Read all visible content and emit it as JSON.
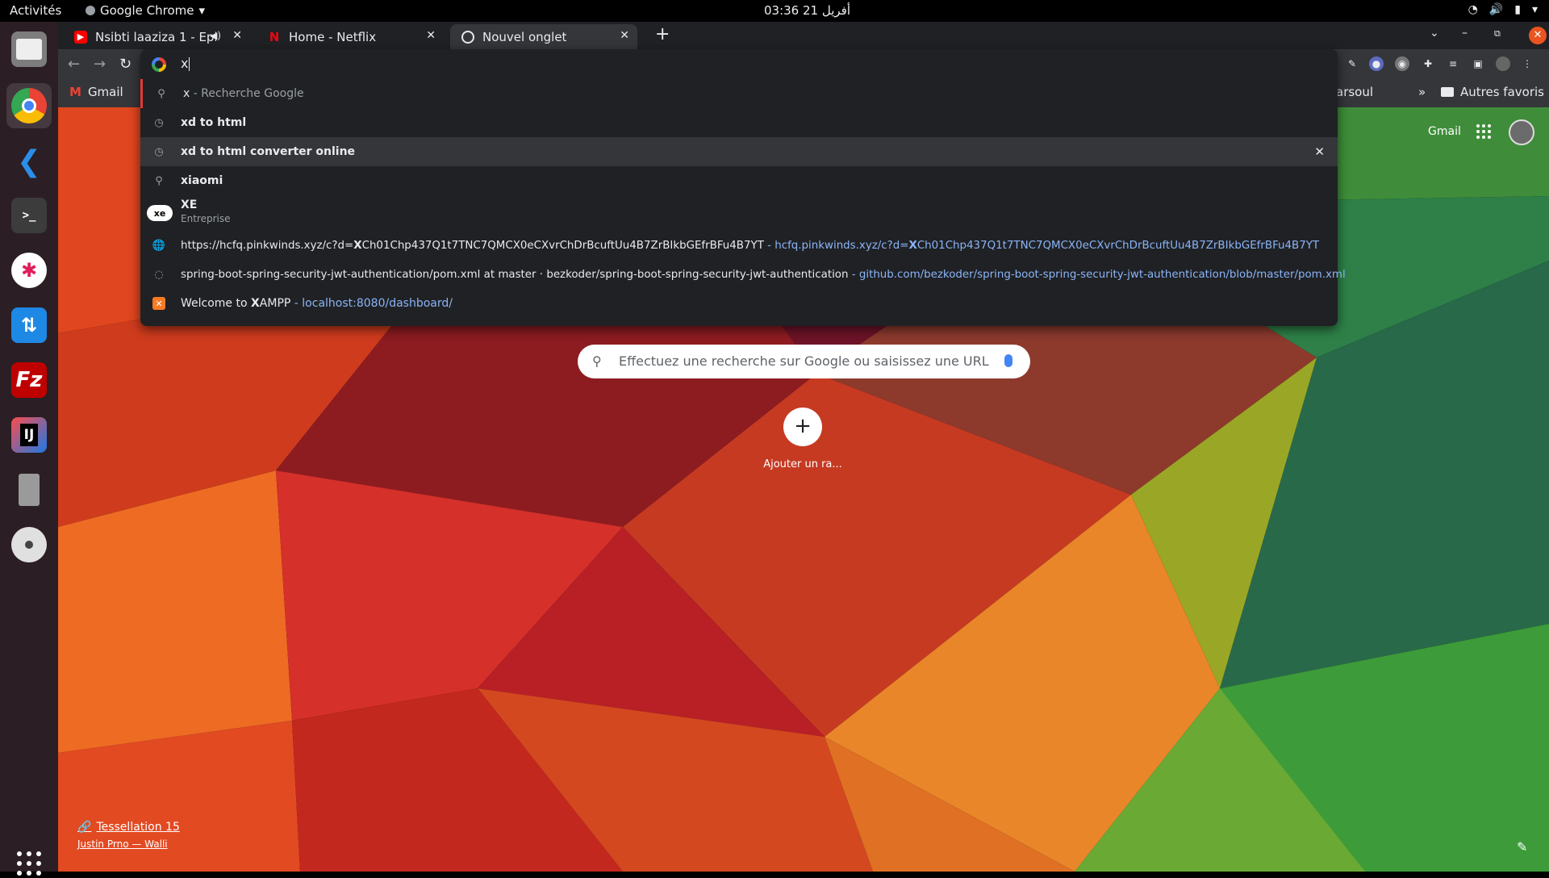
{
  "topbar": {
    "activities": "Activités",
    "app_menu": "Google Chrome",
    "clock": "03:36 أفريل 21"
  },
  "tabs": [
    {
      "title": "Nsibti laaziza 1 - Episo",
      "icon": "youtube-icon",
      "audio": true
    },
    {
      "title": "Home - Netflix",
      "icon": "netflix-icon",
      "audio": false
    },
    {
      "title": "Nouvel onglet",
      "icon": "chrome-icon",
      "audio": false,
      "active": true
    }
  ],
  "omnibox": {
    "query": "x",
    "suggestions": [
      {
        "type": "search",
        "icon": "search-icon",
        "text_bold": "x",
        "text_rest": " - Recherche Google"
      },
      {
        "type": "history",
        "icon": "history-icon",
        "text_bold": "xd to html"
      },
      {
        "type": "history",
        "icon": "history-icon",
        "text_bold": "xd to html converter online",
        "selected": true
      },
      {
        "type": "search",
        "icon": "search-icon",
        "text_bold": "xiaomi"
      },
      {
        "type": "entity",
        "icon": "xe-logo-icon",
        "title": "XE",
        "subtitle": "Entreprise"
      },
      {
        "type": "url",
        "icon": "globe-icon",
        "text_pre": "https://hcfq.pinkwinds.xyz/c?d=",
        "text_bold": "X",
        "text_post": "Ch01Chp437Q1t7TNC7QMCX0eCXvrChDrBcuftUu4B7ZrBIkbGEfrBFu4B7YT",
        "url_pre": "hcfq.pinkwinds.xyz/c?d=",
        "url_bold": "X",
        "url_post": "Ch01Chp437Q1t7TNC7QMCX0eCXvrChDrBcuftUu4B7ZrBIkbGEfrBFu4B7YT"
      },
      {
        "type": "url",
        "icon": "github-icon",
        "text": "spring-boot-spring-security-jwt-authentication/pom.xml at master · bezkoder/spring-boot-spring-security-jwt-authentication",
        "url": "github.com/bezkoder/spring-boot-spring-security-jwt-authentication/blob/master/pom.xml"
      },
      {
        "type": "url",
        "icon": "xampp-icon",
        "text_pre": "Welcome to ",
        "text_bold": "X",
        "text_post": "AMPP",
        "url": "localhost:8080/dashboard/"
      }
    ]
  },
  "bookmarks": {
    "gmail": "Gmail",
    "partial": "arsoul",
    "more": "»",
    "other": "Autres favoris"
  },
  "ntp": {
    "gmail_link": "Gmail",
    "search_placeholder": "Effectuez une recherche sur Google ou saisissez une URL",
    "add_shortcut_label": "Ajouter un ra...",
    "background_title": "Tessellation 15",
    "background_author": "Justin Prno — Walli"
  },
  "colors": {
    "chrome_dark": "#202124",
    "toolbar": "#35363a",
    "link_blue": "#8ab4f8",
    "ubuntu_orange": "#e95420"
  }
}
